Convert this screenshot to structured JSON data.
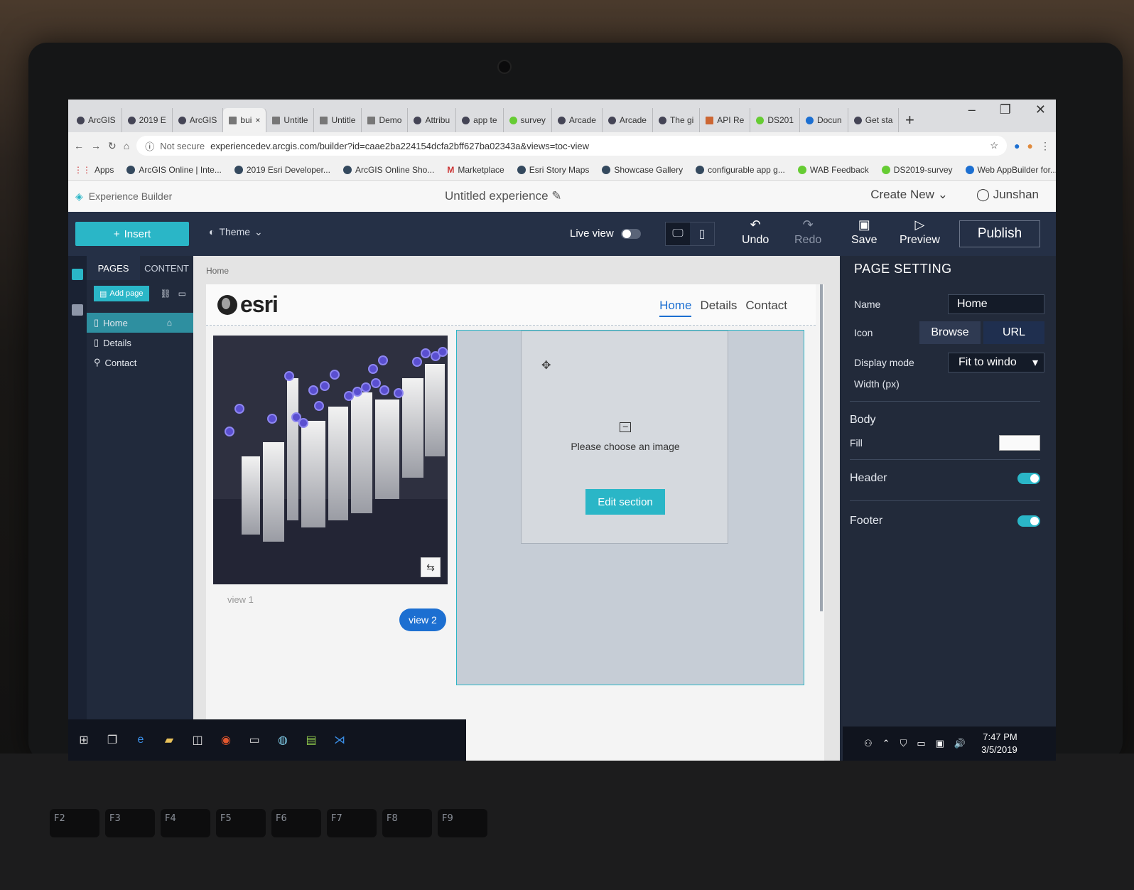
{
  "browser": {
    "tabs": [
      {
        "label": "ArcGIS"
      },
      {
        "label": "2019 E"
      },
      {
        "label": "ArcGIS"
      },
      {
        "label": "bui"
      },
      {
        "label": "Untitle"
      },
      {
        "label": "Untitle"
      },
      {
        "label": "Demo"
      },
      {
        "label": "Attribu"
      },
      {
        "label": "app te"
      },
      {
        "label": "survey"
      },
      {
        "label": "Arcade"
      },
      {
        "label": "Arcade"
      },
      {
        "label": "The gi"
      },
      {
        "label": "API Re"
      },
      {
        "label": "DS201"
      },
      {
        "label": "Docun"
      },
      {
        "label": "Get sta"
      }
    ],
    "new_tab": "+",
    "security": "Not secure",
    "url": "experiencedev.arcgis.com/builder?id=caae2ba224154dcfa2bff627ba02343a&views=toc-view",
    "bookmarks": [
      "Apps",
      "ArcGIS Online | Inte...",
      "2019 Esri Developer...",
      "ArcGIS Online Sho...",
      "Marketplace",
      "Esri Story Maps",
      "Showcase Gallery",
      "configurable app g...",
      "WAB Feedback",
      "DS2019-survey",
      "Web AppBuilder for..."
    ],
    "more": "»"
  },
  "builder": {
    "app_name": "Experience Builder",
    "title": "Untitled experience",
    "create_new": "Create New",
    "user": "Junshan"
  },
  "toolbar": {
    "insert": "Insert",
    "theme": "Theme",
    "live_view": "Live view",
    "undo": "Undo",
    "redo": "Redo",
    "save": "Save",
    "preview": "Preview",
    "publish": "Publish"
  },
  "left_panel": {
    "tabs": [
      "PAGES",
      "CONTENT"
    ],
    "add_page": "Add page",
    "pages": [
      {
        "label": "Home",
        "active": true
      },
      {
        "label": "Details",
        "active": false
      },
      {
        "label": "Contact",
        "active": false
      }
    ]
  },
  "canvas": {
    "breadcrumb": "Home",
    "logo": "esri",
    "nav": [
      "Home",
      "Details",
      "Contact"
    ],
    "view1_label": "view 1",
    "view2_label": "view 2",
    "image_placeholder": "Please choose an image",
    "edit_section": "Edit section"
  },
  "page_setting": {
    "title": "PAGE SETTING",
    "name_label": "Name",
    "name_value": "Home",
    "icon_label": "Icon",
    "browse": "Browse",
    "url": "URL",
    "display_mode_label": "Display mode",
    "display_mode_value": "Fit to windo",
    "width_label": "Width (px)",
    "body_label": "Body",
    "fill_label": "Fill",
    "header_label": "Header",
    "footer_label": "Footer",
    "header_on": true,
    "footer_on": true
  },
  "taskbar": {
    "time": "7:47 PM",
    "date": "3/5/2019"
  },
  "keys": [
    "F2",
    "F3",
    "F4",
    "F5",
    "F6",
    "F7",
    "F8",
    "F9"
  ],
  "colors": {
    "accent": "#2ab6c7",
    "toolbar_bg": "#253046",
    "panel_bg": "#222a3a",
    "link_blue": "#1c6fd1",
    "pin": "#5a4fd0"
  }
}
